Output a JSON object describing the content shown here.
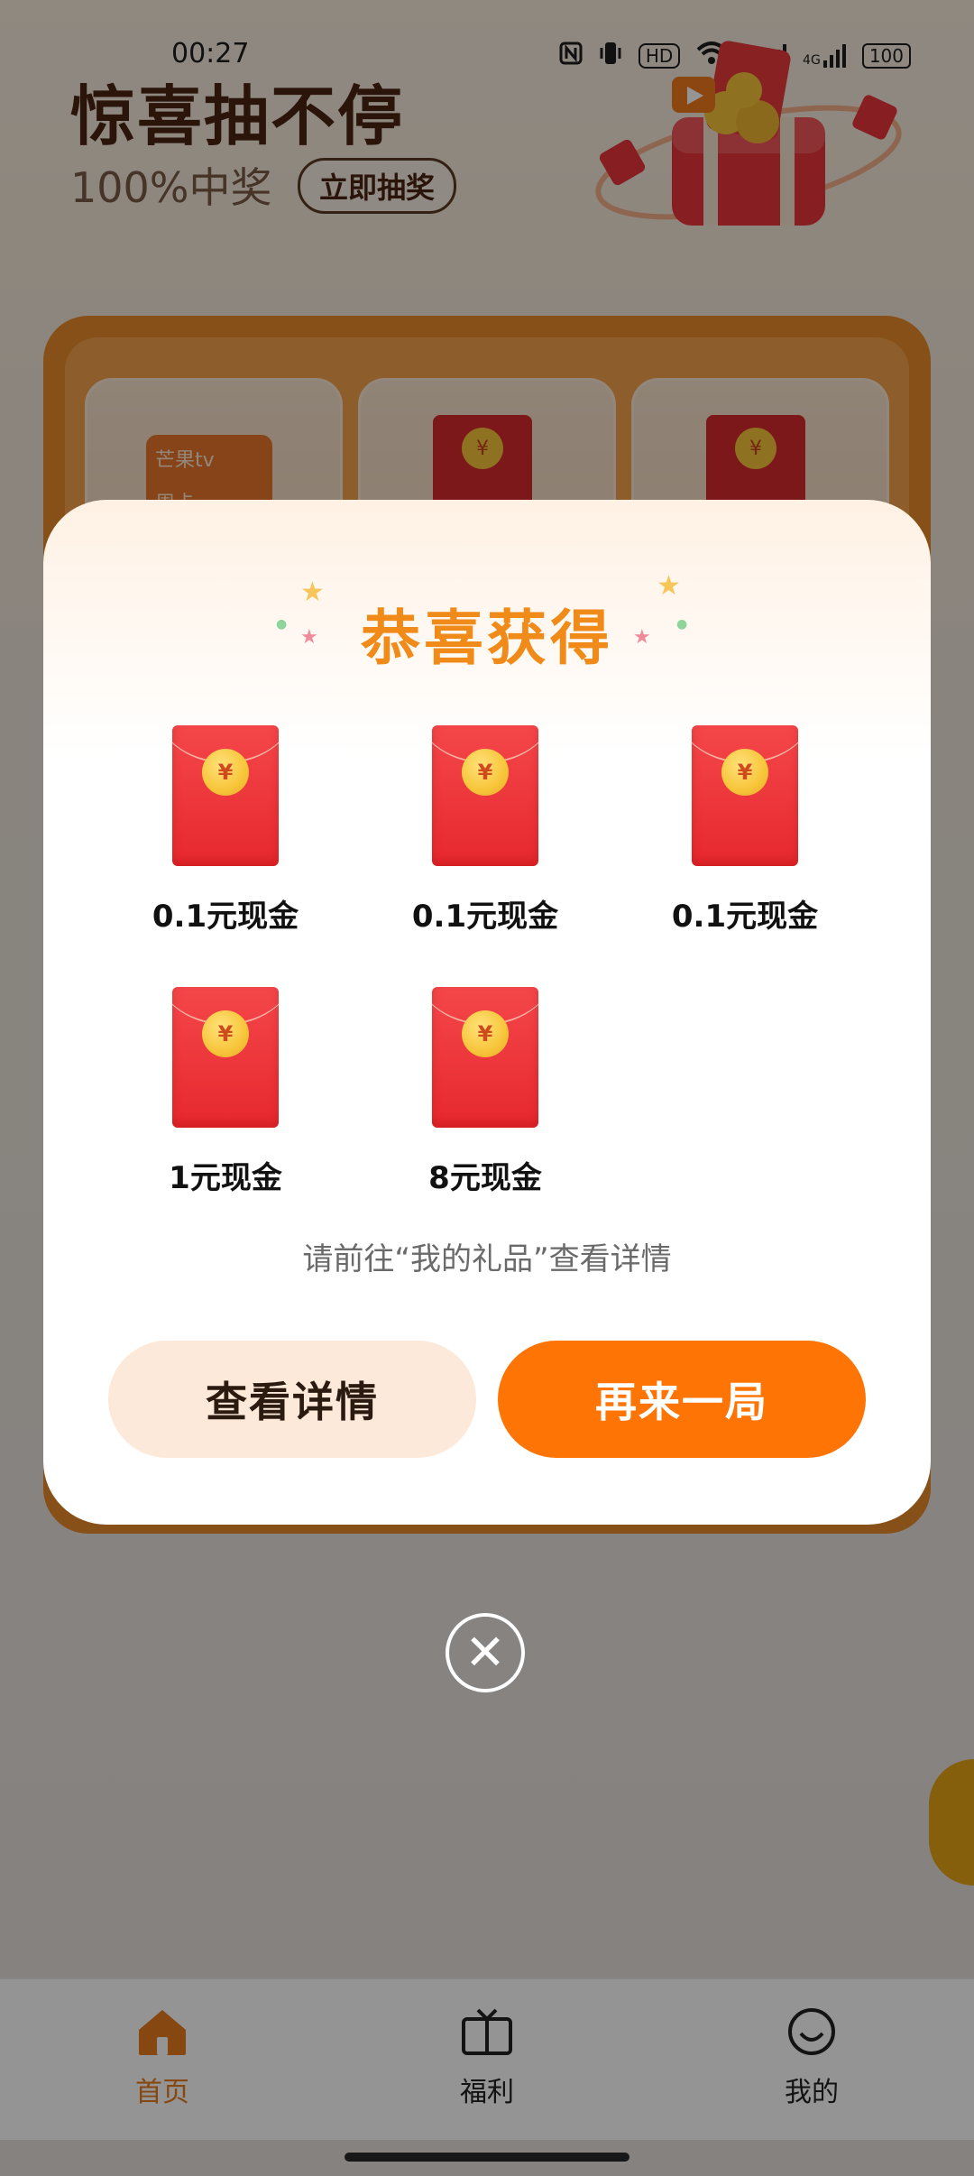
{
  "status_bar": {
    "time": "00:27",
    "icons": [
      "nfc-icon",
      "vibrate-icon",
      "hd-icon",
      "wifi-icon",
      "signal-5g-icon",
      "signal-4g-icon",
      "battery-icon"
    ],
    "hd_label": "HD",
    "net_5g": "5G",
    "net_4g": "4G",
    "battery": "100"
  },
  "hero": {
    "title": "惊喜抽不停",
    "subtitle": "100%中奖",
    "cta": "立即抽奖"
  },
  "grid": {
    "cards": [
      {
        "brand": "芒果tv",
        "label": "周卡"
      },
      {
        "symbol": "¥"
      },
      {
        "symbol": "¥"
      }
    ]
  },
  "modal": {
    "title": "恭喜获得",
    "prizes": [
      {
        "symbol": "¥",
        "label": "0.1元现金"
      },
      {
        "symbol": "¥",
        "label": "0.1元现金"
      },
      {
        "symbol": "¥",
        "label": "0.1元现金"
      },
      {
        "symbol": "¥",
        "label": "1元现金"
      },
      {
        "symbol": "¥",
        "label": "8元现金"
      }
    ],
    "hint": "请前往“我的礼品”查看详情",
    "detail_button": "查看详情",
    "again_button": "再来一局"
  },
  "close_symbol": "✕",
  "bottom_nav": {
    "items": [
      {
        "label": "首页",
        "icon": "home-icon",
        "active": true
      },
      {
        "label": "福利",
        "icon": "tv-gift-icon",
        "active": false
      },
      {
        "label": "我的",
        "icon": "smiley-icon",
        "active": false
      }
    ]
  },
  "colors": {
    "accent": "#fe7405",
    "title_orange": "#f08a18",
    "envelope_red": "#e6282e"
  }
}
